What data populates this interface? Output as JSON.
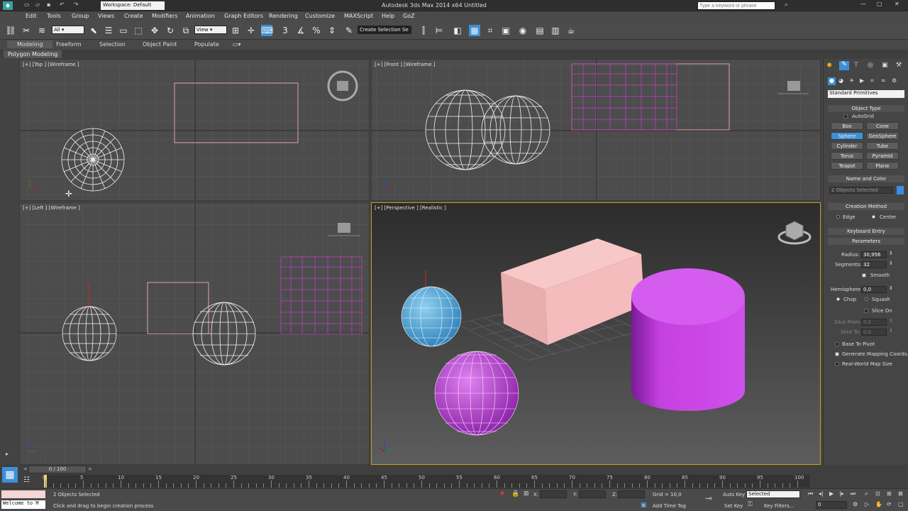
{
  "titlebar": {
    "workspace": "Workspace: Default",
    "title": "Autodesk 3ds Max 2014 x64    Untitled",
    "search_placeholder": "Type a keyword or phrase"
  },
  "menu": [
    "Edit",
    "Tools",
    "Group",
    "Views",
    "Create",
    "Modifiers",
    "Animation",
    "Graph Editors",
    "Rendering",
    "Customize",
    "MAXScript",
    "Help",
    "GoZ"
  ],
  "toolbar": {
    "filter": "All",
    "refcoord": "View",
    "selection_set": "Create Selection Se"
  },
  "ribbon": {
    "tabs": [
      "Modeling",
      "Freeform",
      "Selection",
      "Object Paint",
      "Populate"
    ],
    "sub": "Polygon Modeling"
  },
  "viewports": {
    "top": "[+] [Top ] [Wireframe ]",
    "front": "[+] [Front ] [Wireframe ]",
    "left": "[+] [Left ] [Wireframe ]",
    "perspective": "[+] [Perspective ] [Realistic ]"
  },
  "panel": {
    "dropdown": "Standard Primitives",
    "object_type": "Object Type",
    "autogrid": "AutoGrid",
    "buttons": [
      "Box",
      "Cone",
      "Sphere",
      "GeoSphere",
      "Cylinder",
      "Tube",
      "Torus",
      "Pyramid",
      "Teapot",
      "Plane"
    ],
    "active_button": "Sphere",
    "name_color": "Name and Color",
    "name_value": "2 Objects Selected",
    "swatch_color": "#3a8ee0",
    "creation_method": "Creation Method",
    "edge": "Edge",
    "center": "Center",
    "keyboard_entry": "Keyboard Entry",
    "parameters": "Parameters",
    "radius_label": "Radius:",
    "radius": "30,956",
    "segments_label": "Segments:",
    "segments": "32",
    "smooth": "Smooth",
    "hemisphere_label": "Hemisphere:",
    "hemisphere": "0,0",
    "chop": "Chop",
    "squash": "Squash",
    "slice_on": "Slice On",
    "slice_from_label": "Slice From:",
    "slice_from": "0,0",
    "slice_to_label": "Slice To:",
    "slice_to": "0,0",
    "base_to_pivot": "Base To Pivot",
    "gen_mapping": "Generate Mapping Coords.",
    "real_world": "Real-World Map Size"
  },
  "timeline": {
    "frame": "0 / 100",
    "ticks": [
      "0",
      "5",
      "10",
      "15",
      "20",
      "25",
      "30",
      "35",
      "40",
      "45",
      "50",
      "55",
      "60",
      "65",
      "70",
      "75",
      "80",
      "85",
      "90",
      "95",
      "100"
    ]
  },
  "status": {
    "maxscript": "Welcome to M",
    "selected": "2 Objects Selected",
    "prompt": "Click and drag to begin creation process",
    "x": "X:",
    "y": "Y:",
    "z": "Z:",
    "grid": "Grid = 10,0",
    "add_time_tag": "Add Time Tag",
    "auto_key": "Auto Key",
    "set_key": "Set Key",
    "selected_dd": "Selected",
    "key_filters": "Key Filters...",
    "frame_field": "0"
  }
}
